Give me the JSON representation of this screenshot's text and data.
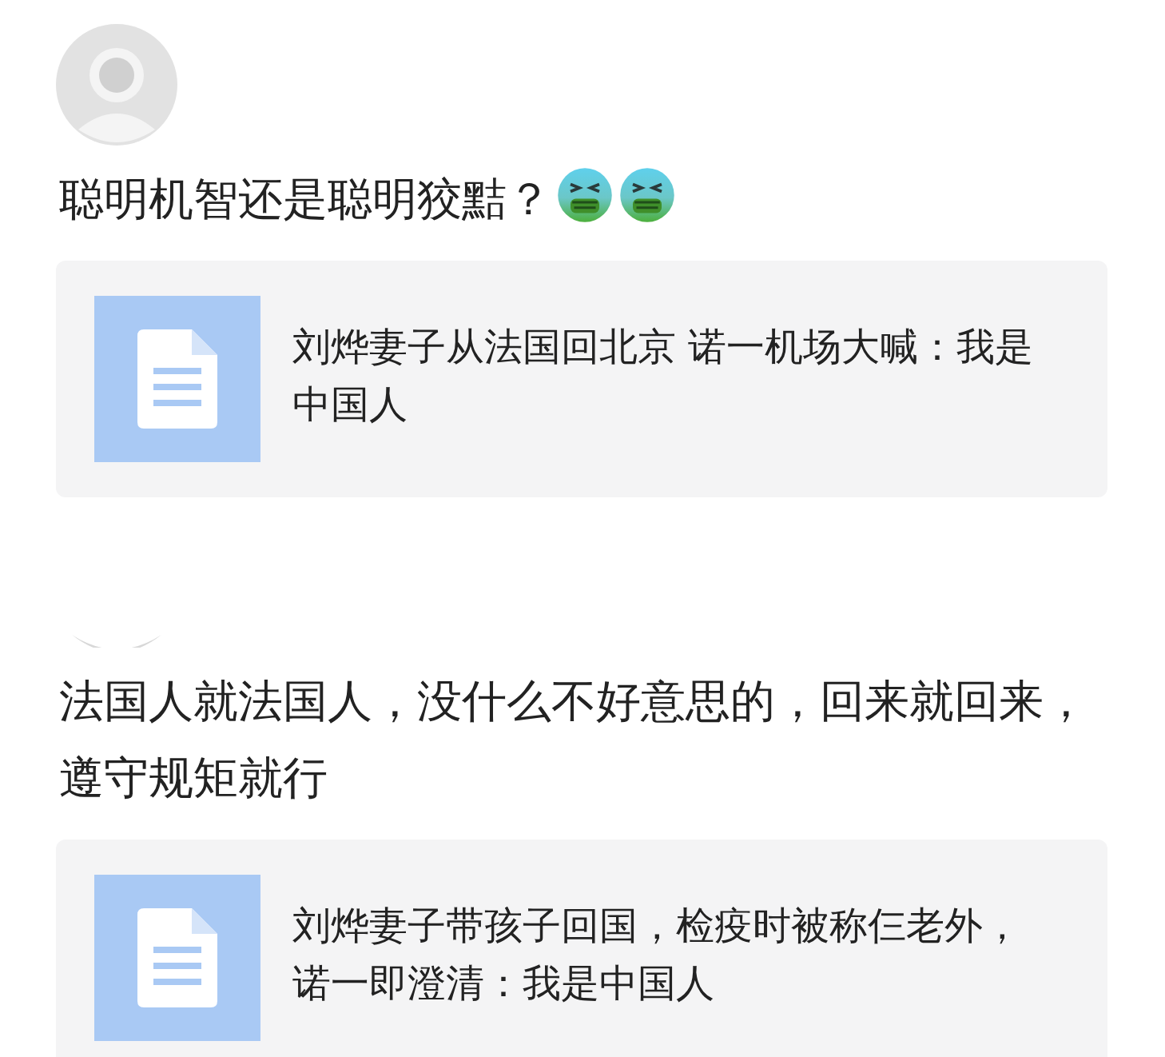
{
  "posts": [
    {
      "avatar": {
        "kind": "full"
      },
      "text": "聪明机智还是聪明狡黠？",
      "emoji": [
        {
          "kind": "nauseated"
        },
        {
          "kind": "nauseated"
        }
      ],
      "link_card": {
        "title": "刘烨妻子从法国回北京 诺一机场大喊：我是中国人"
      }
    },
    {
      "avatar": {
        "kind": "partial"
      },
      "text": "法国人就法国人，没什么不好意思的，回来就回来，遵守规矩就行",
      "link_card": {
        "title": "刘烨妻子带孩子回国，检疫时被称仨老外，诺一即澄清：我是中国人"
      }
    }
  ]
}
